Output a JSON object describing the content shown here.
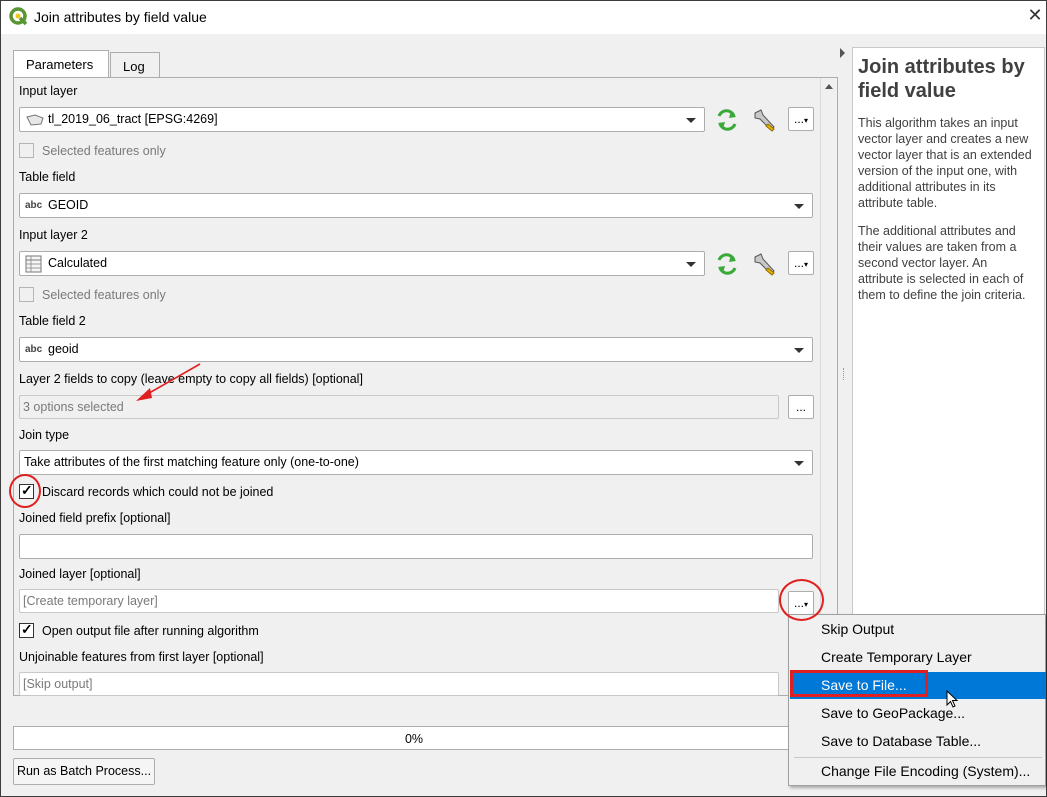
{
  "window": {
    "title": "Join attributes by field value",
    "close": "✕"
  },
  "tabs": [
    {
      "label": "Parameters",
      "active": true
    },
    {
      "label": "Log",
      "active": false
    }
  ],
  "params": {
    "input_layer_label": "Input layer",
    "input_layer_value": "tl_2019_06_tract [EPSG:4269]",
    "selected_only_1": "Selected features only",
    "table_field_label": "Table field",
    "table_field_type": "abc",
    "table_field_value": "GEOID",
    "input_layer2_label": "Input layer 2",
    "input_layer2_value": "Calculated",
    "selected_only_2": "Selected features only",
    "table_field2_label": "Table field 2",
    "table_field2_type": "abc",
    "table_field2_value": "geoid",
    "fields_to_copy_label": "Layer 2 fields to copy (leave empty to copy all fields) [optional]",
    "fields_to_copy_value": "3 options selected",
    "join_type_label": "Join type",
    "join_type_value": "Take attributes of the first matching feature only (one-to-one)",
    "discard_label": "Discard records which could not be joined",
    "discard_checked": true,
    "prefix_label": "Joined field prefix [optional]",
    "prefix_value": "",
    "joined_layer_label": "Joined layer [optional]",
    "joined_layer_placeholder": "[Create temporary layer]",
    "open_output_label": "Open output file after running algorithm",
    "open_output_checked": true,
    "unjoinable_label": "Unjoinable features from first layer [optional]",
    "unjoinable_placeholder": "[Skip output]",
    "ellipsis": "..."
  },
  "help": {
    "title": "Join attributes by field value",
    "para1": "This algorithm takes an input vector layer and creates a new vector layer that is an extended version of the input one, with additional attributes in its attribute table.",
    "para2": "The additional attributes and their values are taken from a second vector layer. An attribute is selected in each of them to define the join criteria."
  },
  "progress": {
    "value": 0,
    "text": "0%"
  },
  "batch_button": "Run as Batch Process...",
  "menu": {
    "items": [
      {
        "label": "Skip Output",
        "highlighted": false
      },
      {
        "label": "Create Temporary Layer",
        "highlighted": false
      },
      {
        "label": "Save to File...",
        "highlighted": true
      },
      {
        "label": "Save to GeoPackage...",
        "highlighted": false
      },
      {
        "label": "Save to Database Table...",
        "highlighted": false
      },
      {
        "label": "Change File Encoding (System)...",
        "highlighted": false
      }
    ]
  },
  "colors": {
    "accent": "#0078d7",
    "annotation": "#e02020",
    "qgis_green": "#589632"
  }
}
